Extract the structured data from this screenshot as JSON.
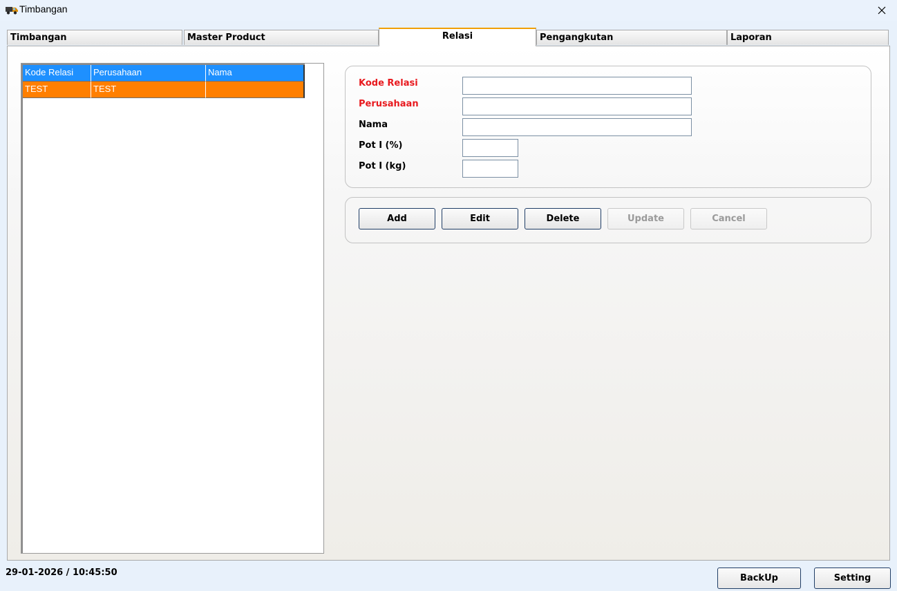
{
  "window": {
    "title": "Timbangan",
    "app_icon": "truck-icon",
    "close_icon": "close-icon"
  },
  "tabs": [
    {
      "label": "Timbangan",
      "active": false
    },
    {
      "label": "Master Product",
      "active": false
    },
    {
      "label": "Relasi",
      "active": true
    },
    {
      "label": "Pengangkutan",
      "active": false
    },
    {
      "label": "Laporan",
      "active": false
    }
  ],
  "grid": {
    "columns": [
      "Kode Relasi",
      "Perusahaan",
      "Nama"
    ],
    "rows": [
      {
        "kode": "TEST",
        "perusahaan": "TEST",
        "nama": "",
        "selected": true
      }
    ],
    "header_color": "#1e90ff",
    "selected_color": "#ff7f00"
  },
  "form": {
    "kode_relasi": {
      "label": "Kode Relasi",
      "value": "",
      "required": true
    },
    "perusahaan": {
      "label": "Perusahaan",
      "value": "",
      "required": true
    },
    "nama": {
      "label": "Nama",
      "value": ""
    },
    "pot_percent": {
      "label": "Pot I (%)",
      "value": ""
    },
    "pot_kg": {
      "label": "Pot I (kg)",
      "value": ""
    },
    "required_color": "#e8191e"
  },
  "actions": {
    "add": "Add",
    "edit": "Edit",
    "delete": "Delete",
    "update": "Update",
    "cancel": "Cancel"
  },
  "status": {
    "datetime": "29-01-2026 / 10:45:50"
  },
  "footer": {
    "backup": "BackUp",
    "setting": "Setting"
  }
}
